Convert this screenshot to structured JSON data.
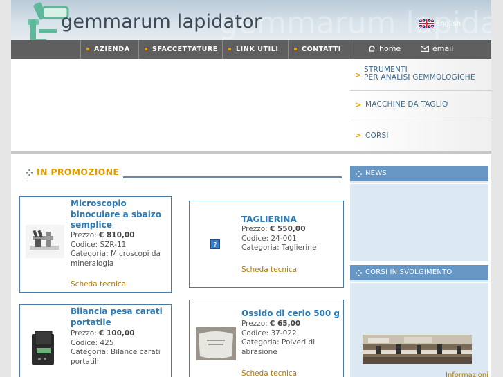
{
  "header": {
    "title": "gemmarum lapidator",
    "watermark": "gemmarum lapidator",
    "language": {
      "label": "English"
    }
  },
  "nav": {
    "items": [
      {
        "label": "AZIENDA"
      },
      {
        "label": "SFACCETTATURE"
      },
      {
        "label": "LINK UTILI"
      },
      {
        "label": "CONTATTI"
      }
    ],
    "home_label": "home",
    "email_label": "email"
  },
  "banner_menu": {
    "items": [
      {
        "line1": "STRUMENTI",
        "line2": "PER ANALISI GEMMOLOGICHE"
      },
      {
        "line1": "MACCHINE DA TAGLIO",
        "line2": ""
      },
      {
        "line1": "CORSI",
        "line2": ""
      }
    ]
  },
  "promo": {
    "title": "IN PROMOZIONE",
    "tech_label": "Scheda tecnica",
    "products": [
      {
        "name_lines": [
          "Microscopio",
          "binoculare a sbalzo",
          "semplice"
        ],
        "price_label": "Prezzo:",
        "price": "€ 810,00",
        "code_label": "Codice:",
        "code": "SZR-11",
        "category_label": "Categoria:",
        "category_lines": [
          "Microscopi da",
          "mineralogia"
        ]
      },
      {
        "name_lines": [
          "TAGLIERINA"
        ],
        "price_label": "Prezzo:",
        "price": "€ 550,00",
        "code_label": "Codice:",
        "code": "24-001",
        "category_label": "Categoria:",
        "category_lines": [
          "Taglierine"
        ]
      },
      {
        "name_lines": [
          "Bilancia pesa carati",
          "portatile"
        ],
        "price_label": "Prezzo:",
        "price": "€ 100,00",
        "code_label": "Codice:",
        "code": "425",
        "category_label": "Categoria:",
        "category_lines": [
          "Bilance carati",
          "portatili"
        ]
      },
      {
        "name_lines": [
          "Ossido di cerio 500 g"
        ],
        "price_label": "Prezzo:",
        "price": "€ 65,00",
        "code_label": "Codice:",
        "code": "37-022",
        "category_label": "Categoria:",
        "category_lines": [
          "Polveri di",
          "abrasione"
        ]
      }
    ]
  },
  "sidebar": {
    "news_title": "NEWS",
    "courses_title": "CORSI IN SVOLGIMENTO",
    "info_link": "Informazioni"
  },
  "colors": {
    "nav_bg": "#5f5f5f",
    "accent_orange": "#e09a00",
    "link_blue": "#2c7ab4",
    "sidebar_head": "#6596c4",
    "sidebar_bg": "#dce9f2"
  },
  "icons": [
    "microscope-logo-icon",
    "uk-flag-icon",
    "home-icon",
    "envelope-icon",
    "dotted-bullet-icon",
    "chevron-right-icon",
    "missing-image-icon"
  ]
}
